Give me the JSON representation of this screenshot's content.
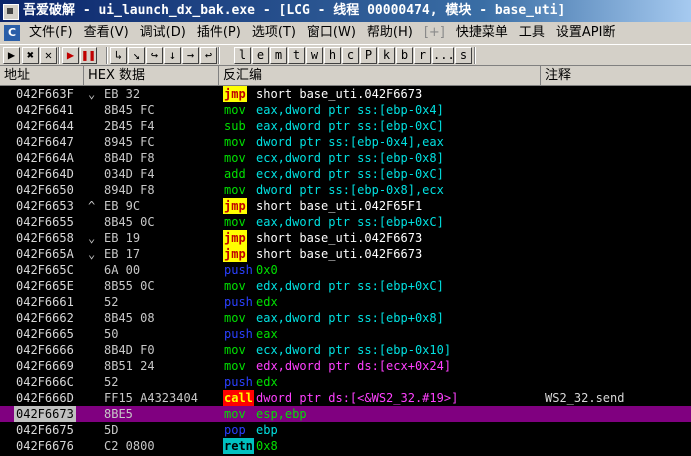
{
  "title": "吾爱破解 - ui_launch_dx_bak.exe - [LCG - 线程 00000474, 模块 - base_uti]",
  "menu": {
    "items": [
      {
        "label": "文件(F)"
      },
      {
        "label": "查看(V)"
      },
      {
        "label": "调试(D)"
      },
      {
        "label": "插件(P)"
      },
      {
        "label": "选项(T)"
      },
      {
        "label": "窗口(W)"
      },
      {
        "label": "帮助(H)"
      },
      {
        "label": "[+]",
        "disabled": true
      },
      {
        "label": "快捷菜单"
      },
      {
        "label": "工具"
      },
      {
        "label": "设置API断"
      }
    ]
  },
  "toolbar": {
    "buttons": [
      "▶",
      "✖",
      "✕",
      "▶",
      "❚❚",
      "↳",
      "↘",
      "↪",
      "↓",
      "→",
      "↩",
      "l",
      "e",
      "m",
      "t",
      "w",
      "h",
      "c",
      "P",
      "k",
      "b",
      "r",
      "...",
      "s"
    ]
  },
  "columns": {
    "address": "地址",
    "hex": "HEX 数据",
    "disasm": "反汇编",
    "comment": "注释"
  },
  "rows": [
    {
      "addr": "042F663F",
      "mark": "⌄",
      "hex": "EB 32",
      "mnem": "jmp",
      "opnd": "short base_uti.042F6673",
      "kind": "jmp"
    },
    {
      "addr": "042F6641",
      "mark": "",
      "hex": "8B45 FC",
      "mnem": "mov",
      "opnd": "eax,dword ptr ss:[ebp-0x4]",
      "kind": "mov"
    },
    {
      "addr": "042F6644",
      "mark": "",
      "hex": "2B45 F4",
      "mnem": "sub",
      "opnd": "eax,dword ptr ss:[ebp-0xC]",
      "kind": "sub"
    },
    {
      "addr": "042F6647",
      "mark": "",
      "hex": "8945 FC",
      "mnem": "mov",
      "opnd": "dword ptr ss:[ebp-0x4],eax",
      "kind": "mov"
    },
    {
      "addr": "042F664A",
      "mark": "",
      "hex": "8B4D F8",
      "mnem": "mov",
      "opnd": "ecx,dword ptr ss:[ebp-0x8]",
      "kind": "mov"
    },
    {
      "addr": "042F664D",
      "mark": "",
      "hex": "034D F4",
      "mnem": "add",
      "opnd": "ecx,dword ptr ss:[ebp-0xC]",
      "kind": "add"
    },
    {
      "addr": "042F6650",
      "mark": "",
      "hex": "894D F8",
      "mnem": "mov",
      "opnd": "dword ptr ss:[ebp-0x8],ecx",
      "kind": "mov"
    },
    {
      "addr": "042F6653",
      "mark": "^",
      "hex": "EB 9C",
      "mnem": "jmp",
      "opnd": "short base_uti.042F65F1",
      "kind": "jmp"
    },
    {
      "addr": "042F6655",
      "mark": "",
      "hex": "8B45 0C",
      "mnem": "mov",
      "opnd": "eax,dword ptr ss:[ebp+0xC]",
      "kind": "mov"
    },
    {
      "addr": "042F6658",
      "mark": "⌄",
      "hex": "EB 19",
      "mnem": "jmp",
      "opnd": "short base_uti.042F6673",
      "kind": "jmp"
    },
    {
      "addr": "042F665A",
      "mark": "⌄",
      "hex": "EB 17",
      "mnem": "jmp",
      "opnd": "short base_uti.042F6673",
      "kind": "jmp"
    },
    {
      "addr": "042F665C",
      "mark": "",
      "hex": "6A 00",
      "mnem": "push",
      "opnd": "0x0",
      "kind": "pushnum"
    },
    {
      "addr": "042F665E",
      "mark": "",
      "hex": "8B55 0C",
      "mnem": "mov",
      "opnd": "edx,dword ptr ss:[ebp+0xC]",
      "kind": "mov"
    },
    {
      "addr": "042F6661",
      "mark": "",
      "hex": "52",
      "mnem": "push",
      "opnd": "edx",
      "kind": "push"
    },
    {
      "addr": "042F6662",
      "mark": "",
      "hex": "8B45 08",
      "mnem": "mov",
      "opnd": "eax,dword ptr ss:[ebp+0x8]",
      "kind": "mov"
    },
    {
      "addr": "042F6665",
      "mark": "",
      "hex": "50",
      "mnem": "push",
      "opnd": "eax",
      "kind": "push"
    },
    {
      "addr": "042F6666",
      "mark": "",
      "hex": "8B4D F0",
      "mnem": "mov",
      "opnd": "ecx,dword ptr ss:[ebp-0x10]",
      "kind": "mov"
    },
    {
      "addr": "042F6669",
      "mark": "",
      "hex": "8B51 24",
      "mnem": "mov",
      "opnd": "edx,dword ptr ds:[ecx+0x24]",
      "kind": "movmag"
    },
    {
      "addr": "042F666C",
      "mark": "",
      "hex": "52",
      "mnem": "push",
      "opnd": "edx",
      "kind": "push"
    },
    {
      "addr": "042F666D",
      "mark": "",
      "hex": "FF15 A4323404",
      "mnem": "call",
      "opnd": "dword ptr ds:[<&WS2_32.#19>]",
      "kind": "call",
      "comment": "WS2_32.send"
    },
    {
      "addr": "042F6673",
      "mark": "",
      "hex": "8BE5",
      "mnem": "mov",
      "opnd": "esp,ebp",
      "kind": "movgreen",
      "selected": true
    },
    {
      "addr": "042F6675",
      "mark": "",
      "hex": "5D",
      "mnem": "pop",
      "opnd": "ebp",
      "kind": "pop"
    },
    {
      "addr": "042F6676",
      "mark": "",
      "hex": "C2 0800",
      "mnem": "retn",
      "opnd": "0x8",
      "kind": "retn"
    }
  ]
}
